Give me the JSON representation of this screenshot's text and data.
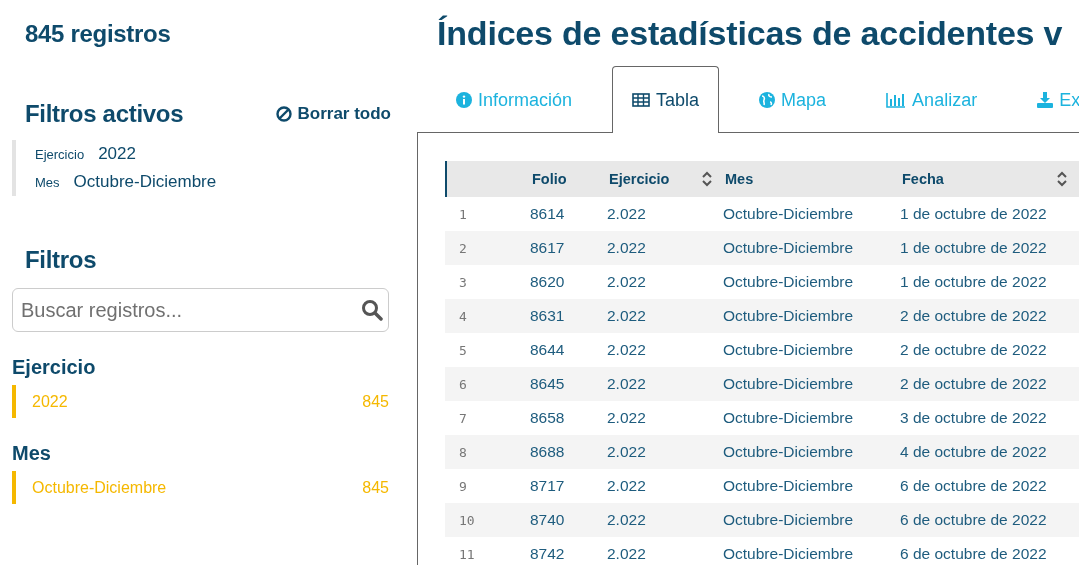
{
  "sidebar": {
    "record_count": "845 registros",
    "active_filters": {
      "title": "Filtros activos",
      "clear_button": "Borrar todo",
      "items": [
        {
          "label": "Ejercicio",
          "value": "2022"
        },
        {
          "label": "Mes",
          "value": "Octubre-Diciembre"
        }
      ]
    },
    "filters": {
      "title": "Filtros",
      "search": {
        "placeholder": "Buscar registros..."
      },
      "groups": [
        {
          "title": "Ejercicio",
          "options": [
            {
              "label": "2022",
              "count": "845",
              "selected": true
            }
          ]
        },
        {
          "title": "Mes",
          "options": [
            {
              "label": "Octubre-Diciembre",
              "count": "845",
              "selected": true
            }
          ]
        }
      ]
    }
  },
  "main": {
    "title": "Índices de estadísticas de accidentes v",
    "tabs": [
      {
        "label": "Información",
        "selected": false
      },
      {
        "label": "Tabla",
        "selected": true
      },
      {
        "label": "Mapa",
        "selected": false
      },
      {
        "label": "Analizar",
        "selected": false
      },
      {
        "label": "Ex",
        "selected": false
      }
    ],
    "table": {
      "columns": [
        {
          "label": "Folio",
          "sortable": false
        },
        {
          "label": "Ejercicio",
          "sortable": true
        },
        {
          "label": "Mes",
          "sortable": false
        },
        {
          "label": "Fecha",
          "sortable": true
        }
      ],
      "rows": [
        {
          "index": "1",
          "cells": [
            "8614",
            "2.022",
            "Octubre-Diciembre",
            "1 de octubre de 2022"
          ]
        },
        {
          "index": "2",
          "cells": [
            "8617",
            "2.022",
            "Octubre-Diciembre",
            "1 de octubre de 2022"
          ]
        },
        {
          "index": "3",
          "cells": [
            "8620",
            "2.022",
            "Octubre-Diciembre",
            "1 de octubre de 2022"
          ]
        },
        {
          "index": "4",
          "cells": [
            "8631",
            "2.022",
            "Octubre-Diciembre",
            "2 de octubre de 2022"
          ]
        },
        {
          "index": "5",
          "cells": [
            "8644",
            "2.022",
            "Octubre-Diciembre",
            "2 de octubre de 2022"
          ]
        },
        {
          "index": "6",
          "cells": [
            "8645",
            "2.022",
            "Octubre-Diciembre",
            "2 de octubre de 2022"
          ]
        },
        {
          "index": "7",
          "cells": [
            "8658",
            "2.022",
            "Octubre-Diciembre",
            "3 de octubre de 2022"
          ]
        },
        {
          "index": "8",
          "cells": [
            "8688",
            "2.022",
            "Octubre-Diciembre",
            "4 de octubre de 2022"
          ]
        },
        {
          "index": "9",
          "cells": [
            "8717",
            "2.022",
            "Octubre-Diciembre",
            "6 de octubre de 2022"
          ]
        },
        {
          "index": "10",
          "cells": [
            "8740",
            "2.022",
            "Octubre-Diciembre",
            "6 de octubre de 2022"
          ]
        },
        {
          "index": "11",
          "cells": [
            "8742",
            "2.022",
            "Octubre-Diciembre",
            "6 de octubre de 2022"
          ]
        }
      ]
    }
  }
}
